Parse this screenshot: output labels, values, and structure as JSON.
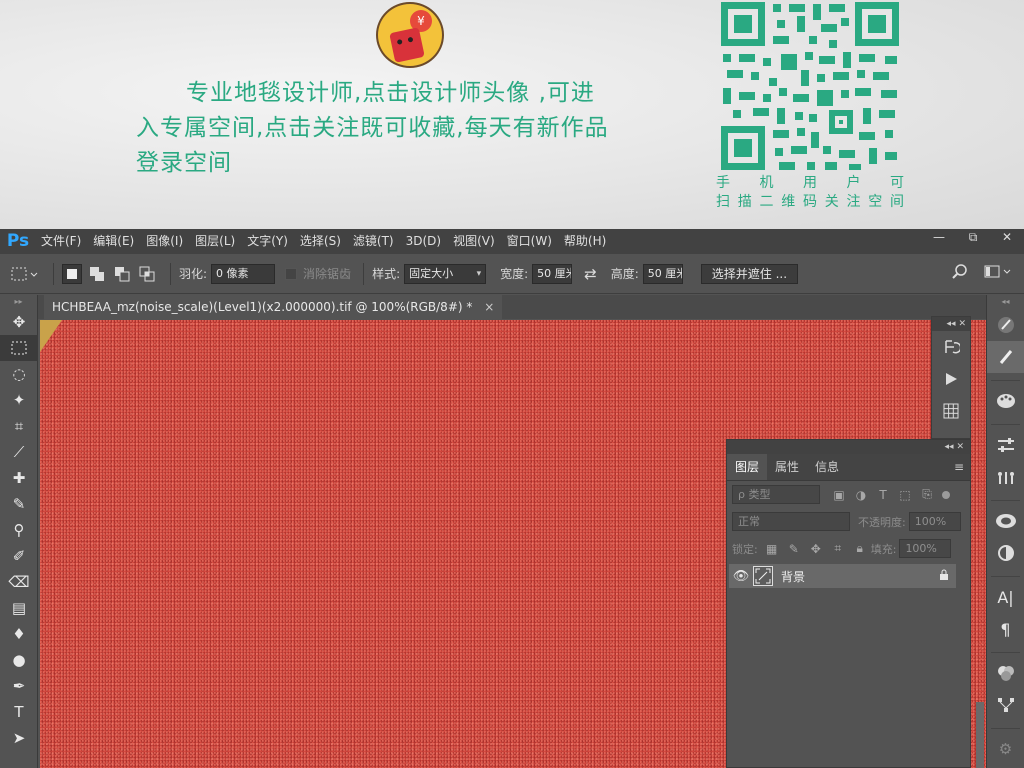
{
  "banner": {
    "promo_line1": "专业地毯设计师,点击设计师头像 ,可进",
    "promo_line2": "入专属空间,点击关注既可收藏,每天有新作品",
    "promo_line3": "登录空间",
    "avatar_symbol": "¥",
    "qr_caption_line1": "手 机 用 户 可",
    "qr_caption_line2": "扫描二维码关注空间",
    "accent_color": "#2aa982"
  },
  "app": {
    "logo": "Ps",
    "menus": [
      "文件(F)",
      "编辑(E)",
      "图像(I)",
      "图层(L)",
      "文字(Y)",
      "选择(S)",
      "滤镜(T)",
      "3D(D)",
      "视图(V)",
      "窗口(W)",
      "帮助(H)"
    ],
    "window_controls": {
      "minimize": "—",
      "restore": "⧉",
      "close": "✕"
    }
  },
  "options": {
    "feather_label": "羽化:",
    "feather_value": "0 像素",
    "antialias_label": "消除锯齿",
    "style_label": "样式:",
    "style_value": "固定大小",
    "width_label": "宽度:",
    "width_value": "50 厘米",
    "swap_icon": "⇄",
    "height_label": "高度:",
    "height_value": "50 厘米",
    "select_mask_button": "选择并遮住 ..."
  },
  "document": {
    "tab_title": "HCHBEAA_mz(noise_scale)(Level1)(x2.000000).tif @ 100%(RGB/8#) *",
    "close": "×",
    "canvas_color": "#d3463d"
  },
  "tools": [
    "✥",
    "⬚",
    "◌",
    "✦",
    "⌗",
    "⟋",
    "✚",
    "✎",
    "⚲",
    "✐",
    "⌫",
    "▤",
    "♦",
    "●",
    "✒",
    "T",
    "➤"
  ],
  "layers_panel": {
    "tabs": [
      "图层",
      "属性",
      "信息"
    ],
    "filter_placeholder": "ρ 类型",
    "blend_mode": "正常",
    "opacity_label": "不透明度:",
    "opacity_value": "100%",
    "lock_label": "锁定:",
    "fill_label": "填充:",
    "fill_value": "100%",
    "layer_name": "背景",
    "menu_icon": "≡",
    "collapse": "◂◂",
    "close": "✕"
  },
  "mini_panel": {
    "collapse": "◂◂",
    "close": "✕"
  },
  "right_strip_icons": [
    "brush-preset-icon",
    "brush-icon",
    "palette-icon",
    "adjustment-icon",
    "channel-icon",
    "libraries-icon",
    "circle-half-icon",
    "character-icon",
    "paragraph-icon",
    "color-icon",
    "path-icon",
    "settings-icon"
  ]
}
